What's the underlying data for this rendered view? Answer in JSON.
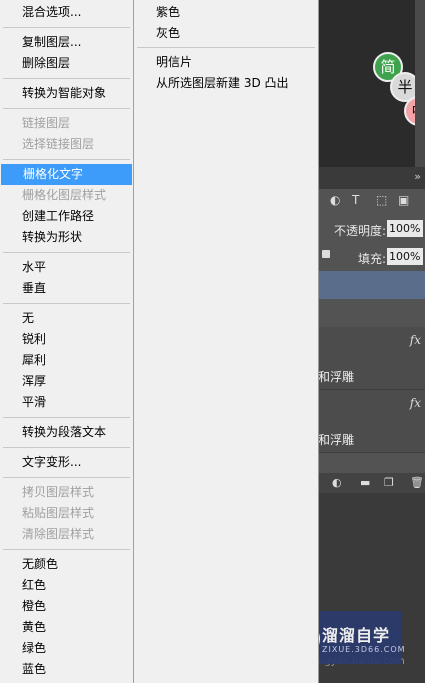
{
  "context_menu": {
    "items": [
      {
        "label": "混合选项...",
        "enabled": true
      },
      {
        "label": "复制图层...",
        "enabled": true
      },
      {
        "label": "删除图层",
        "enabled": true
      },
      {
        "label": "转换为智能对象",
        "enabled": true
      },
      {
        "label": "链接图层",
        "enabled": false
      },
      {
        "label": "选择链接图层",
        "enabled": false
      },
      {
        "label": "栅格化文字",
        "enabled": true,
        "highlighted": true
      },
      {
        "label": "栅格化图层样式",
        "enabled": false
      },
      {
        "label": "创建工作路径",
        "enabled": true
      },
      {
        "label": "转换为形状",
        "enabled": true
      },
      {
        "label": "水平",
        "enabled": true
      },
      {
        "label": "垂直",
        "enabled": true
      },
      {
        "label": "无",
        "enabled": true
      },
      {
        "label": "锐利",
        "enabled": true
      },
      {
        "label": "犀利",
        "enabled": true
      },
      {
        "label": "浑厚",
        "enabled": true
      },
      {
        "label": "平滑",
        "enabled": true
      },
      {
        "label": "转换为段落文本",
        "enabled": true
      },
      {
        "label": "文字变形...",
        "enabled": true
      },
      {
        "label": "拷贝图层样式",
        "enabled": false
      },
      {
        "label": "粘贴图层样式",
        "enabled": false
      },
      {
        "label": "清除图层样式",
        "enabled": false
      },
      {
        "label": "无颜色",
        "enabled": true
      },
      {
        "label": "红色",
        "enabled": true
      },
      {
        "label": "橙色",
        "enabled": true
      },
      {
        "label": "黄色",
        "enabled": true
      },
      {
        "label": "绿色",
        "enabled": true
      },
      {
        "label": "蓝色",
        "enabled": true
      }
    ],
    "submenu_items": [
      {
        "label": "紫色"
      },
      {
        "label": "灰色"
      },
      {
        "label": "明信片"
      },
      {
        "label": "从所选图层新建 3D 凸出"
      }
    ]
  },
  "canvas": {
    "bubbles": [
      "简",
      "半",
      "中"
    ],
    "bubble_colors": [
      "#3fa34d",
      "#d9d9d9",
      "#f2a3a8"
    ]
  },
  "layers_panel": {
    "tab_expand_icon": "double-chevron-right",
    "opacity_label": "不透明度:",
    "opacity_value": "100%",
    "fill_label": "填充:",
    "fill_value": "100%",
    "layers": [
      {
        "effects_text": "和浮雕",
        "fx": "fx"
      },
      {
        "effects_text": "和浮雕",
        "fx": "fx"
      }
    ]
  },
  "watermark": {
    "brand_text": "溜溜自学",
    "brand_url": "ZIXUE.3D66.COM",
    "overlay_url": "ngyan.baidu.com"
  },
  "colors": {
    "highlight": "#3d9bfa",
    "menu_bg": "#f0f0f0",
    "disabled_text": "#a0a0a0"
  }
}
